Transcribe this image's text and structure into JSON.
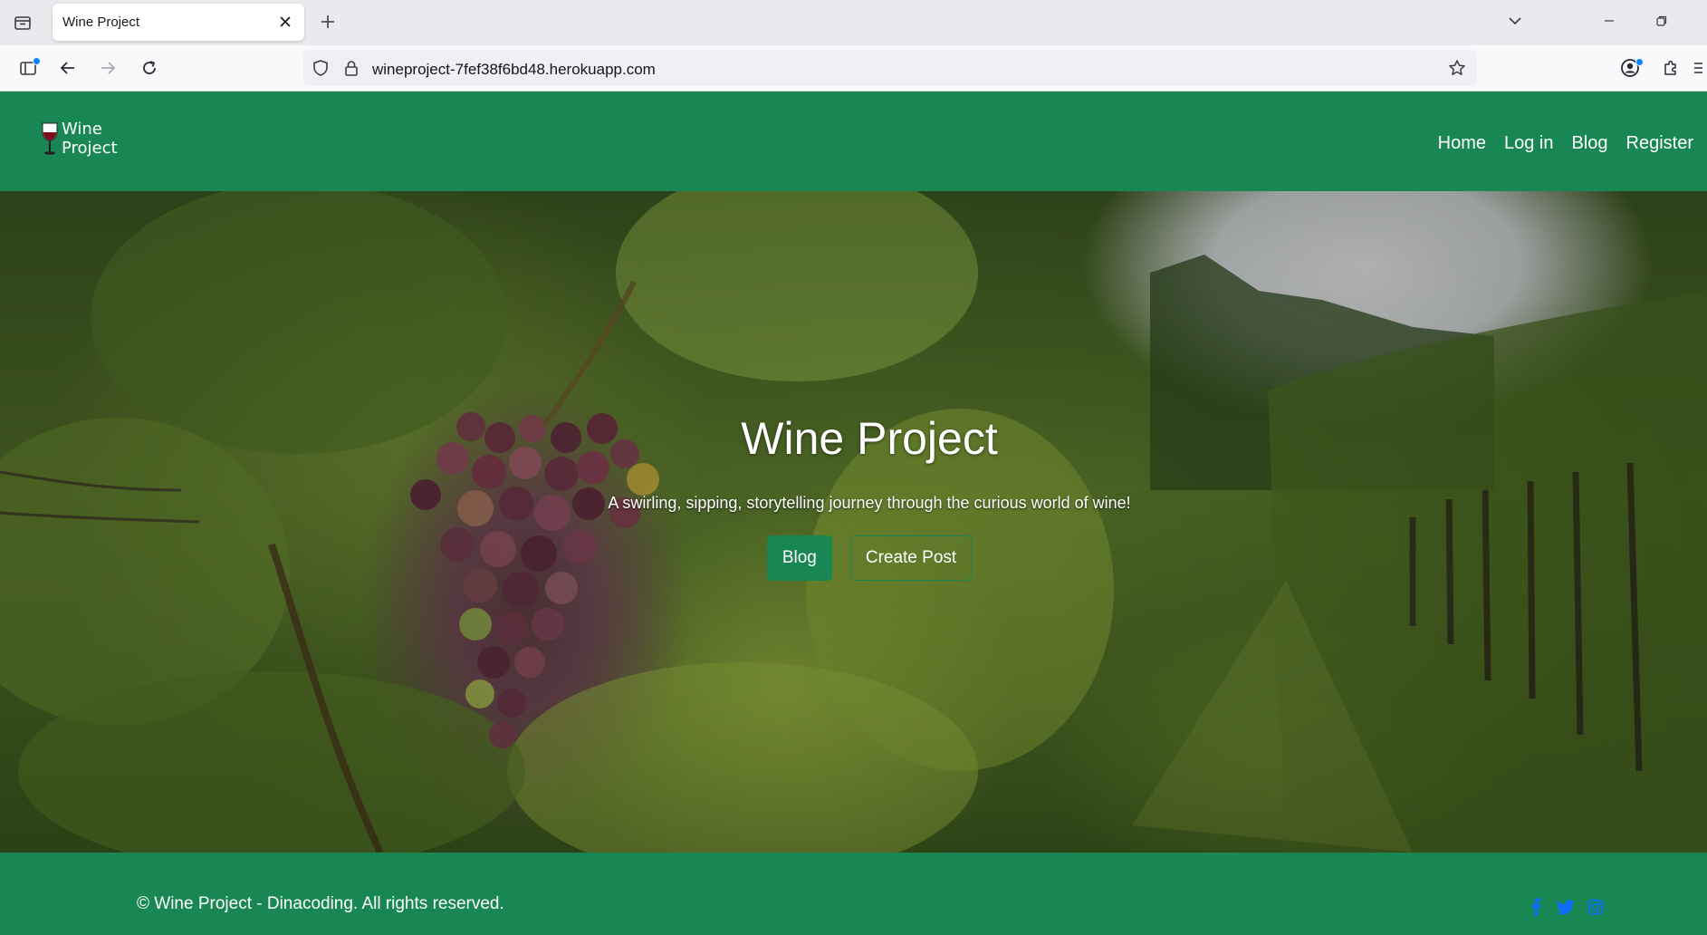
{
  "browser": {
    "tab_title": "Wine Project",
    "url": "wineproject-7fef38f6bd48.herokuapp.com"
  },
  "site": {
    "logo_line1": "Wine",
    "logo_line2": "Project",
    "nav": [
      "Home",
      "Log in",
      "Blog",
      "Register"
    ],
    "hero_title": "Wine Project",
    "hero_subtitle": "A swirling, sipping, storytelling journey through the curious world of wine!",
    "hero_buttons": [
      "Blog",
      "Create Post"
    ],
    "footer_text": "© Wine Project - Dinacoding. All rights reserved.",
    "social_icons": [
      "facebook-icon",
      "twitter-icon",
      "instagram-icon"
    ],
    "colors": {
      "brand_green": "#198754",
      "social_blue": "#0d6efd"
    }
  }
}
